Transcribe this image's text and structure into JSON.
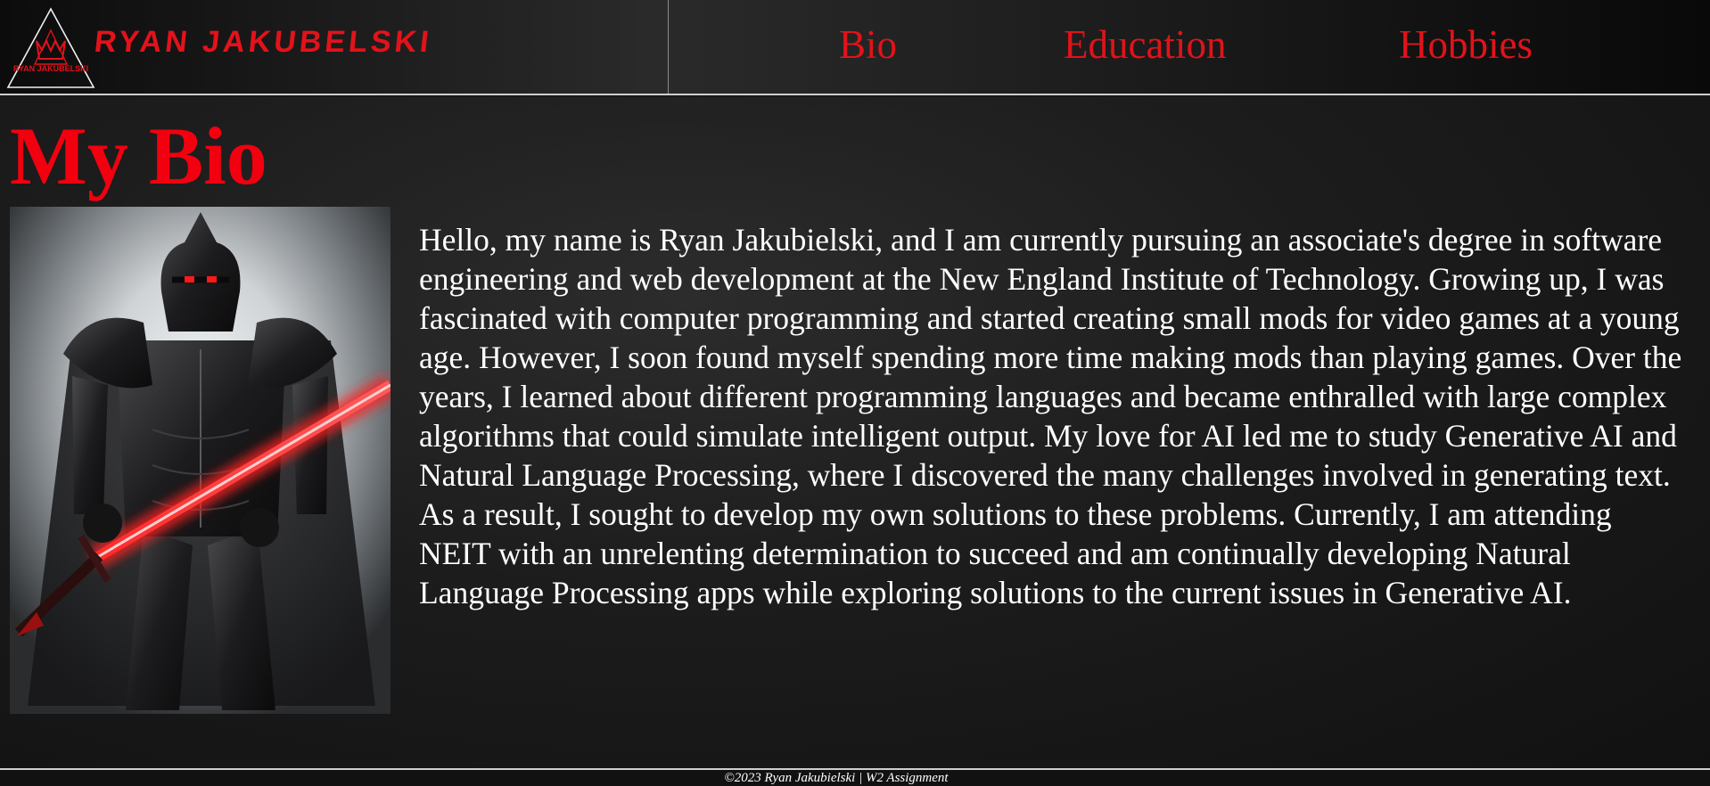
{
  "header": {
    "logo": {
      "name": "Ryan Jakubielski",
      "text": "RYAN JAKUBELSKI",
      "icon_text": "RYAN JAKUBELSKI",
      "icon": "triangle-crown-logo-icon"
    },
    "nav": [
      {
        "label": "Bio"
      },
      {
        "label": "Education"
      },
      {
        "label": "Hobbies"
      }
    ]
  },
  "main": {
    "title": "My Bio",
    "image": {
      "alt": "Dark armored knight holding a glowing red sword",
      "icon": "knight-portrait-image"
    },
    "bio": "Hello, my name is Ryan Jakubielski, and I am currently pursuing an associate's degree in software engineering and web development at the New England Institute of Technology. Growing up, I was fascinated with computer programming and started creating small mods for video games at a young age. However, I soon found myself spending more time making mods than playing games. Over the years, I learned about different programming languages and became enthralled with large complex algorithms that could simulate intelligent output. My love for AI led me to study Generative AI and Natural Language Processing, where I discovered the many challenges involved in generating text. As a result, I sought to develop my own solutions to these problems. Currently, I am attending NEIT with an unrelenting determination to succeed and am continually developing Natural Language Processing apps while exploring solutions to the current issues in Generative AI."
  },
  "footer": {
    "text": "©2023 Ryan Jakubielski | W2 Assignment"
  },
  "colors": {
    "accent_red": "#e3121a",
    "background": "#181818",
    "text": "#ffffff",
    "divider": "#cfcfcf"
  }
}
